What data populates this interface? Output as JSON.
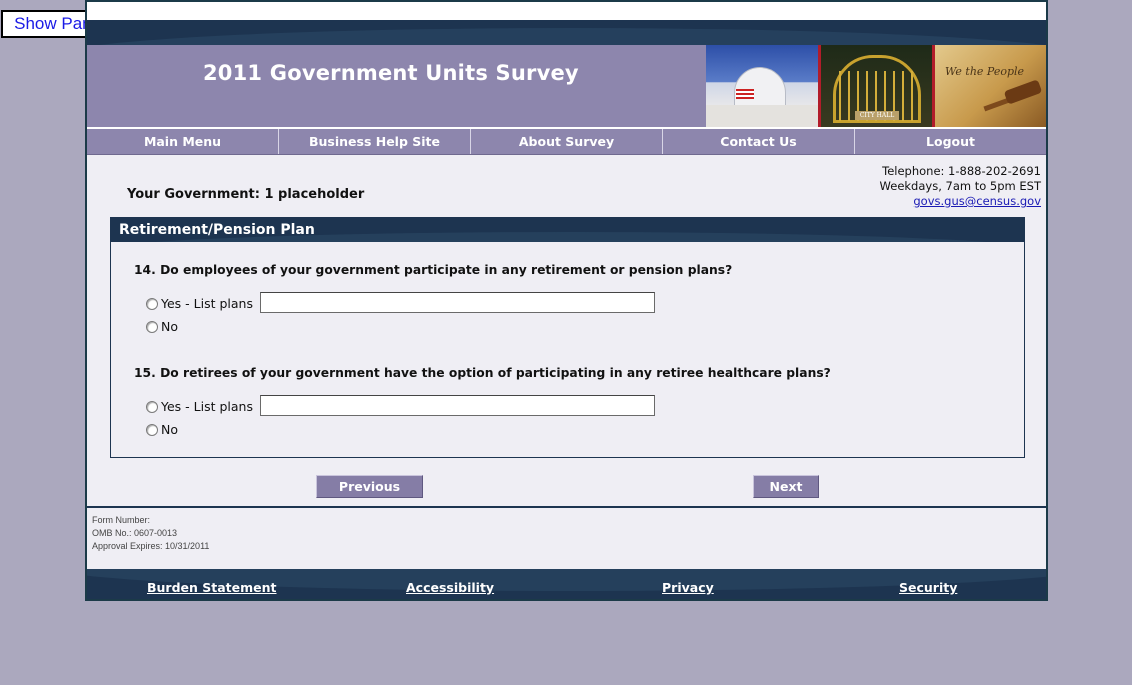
{
  "show_panel_label": "Show Panel",
  "header": {
    "title": "2011 Government Units Survey",
    "city_hall_plate": "CITY HALL",
    "parchment_script": "We the People"
  },
  "nav": [
    {
      "label": "Main Menu"
    },
    {
      "label": "Business Help Site"
    },
    {
      "label": "About Survey"
    },
    {
      "label": "Contact Us"
    },
    {
      "label": "Logout"
    }
  ],
  "contact": {
    "telephone": "Telephone: 1-888-202-2691",
    "hours": "Weekdays, 7am to 5pm EST",
    "email": "govs.gus@census.gov"
  },
  "government_label": "Your Government: 1 placeholder",
  "section": {
    "title": "Retirement/Pension Plan",
    "questions": [
      {
        "text": "14. Do employees of your government participate in any retirement or pension plans?",
        "yes_label": "Yes - List plans",
        "no_label": "No",
        "plans_value": ""
      },
      {
        "text": "15. Do retirees of your government have the option of participating in any retiree healthcare plans?",
        "yes_label": "Yes - List plans",
        "no_label": "No",
        "plans_value": ""
      }
    ]
  },
  "buttons": {
    "previous": "Previous",
    "next": "Next"
  },
  "form_info": {
    "form_number": "Form Number:",
    "omb": "OMB No.: 0607-0013",
    "expires": "Approval Expires: 10/31/2011"
  },
  "footer_links": [
    {
      "label": "Burden Statement"
    },
    {
      "label": "Accessibility"
    },
    {
      "label": "Privacy"
    },
    {
      "label": "Security"
    }
  ]
}
